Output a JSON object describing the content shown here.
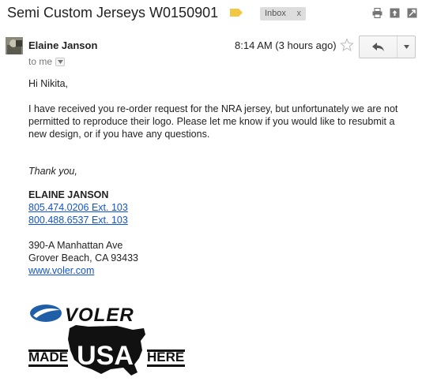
{
  "subject": {
    "title": "Semi Custom Jerseys W0150901",
    "label_chip": "Inbox",
    "label_remove": "x"
  },
  "top_actions": [
    "print-icon",
    "new-window-icon",
    "expand-icon"
  ],
  "message_header": {
    "sender_name": "Elaine Janson",
    "recipient": "to me",
    "timestamp": "8:14 AM (3 hours ago)"
  },
  "message_body": {
    "greeting": "Hi Nikita,",
    "paragraph": "I have received you re-order request for the NRA jersey, but unfortunately we are not permitted to reproduce their logo. Please let me know if you would like to resubmit a new design, or if you have any questions.",
    "closing": "Thank you,"
  },
  "signature": {
    "name": "ELAINE JANSON",
    "phone_1": "805.474.0206 Ext. 103",
    "phone_2": "800.488.6537 Ext. 103",
    "address_line_1": "390-A Manhattan Ave",
    "address_line_2": "Grover Beach, CA 93433",
    "website": "www.voler.com"
  },
  "logos": {
    "brand_text": "VOLER",
    "made_text": "MADE",
    "usa_text": "USA",
    "here_text": "HERE",
    "brand_color": "#1f5fa8"
  },
  "colors": {
    "link": "#1155cc",
    "label_tag": "#f2c744",
    "chip_bg": "#dddddd"
  }
}
